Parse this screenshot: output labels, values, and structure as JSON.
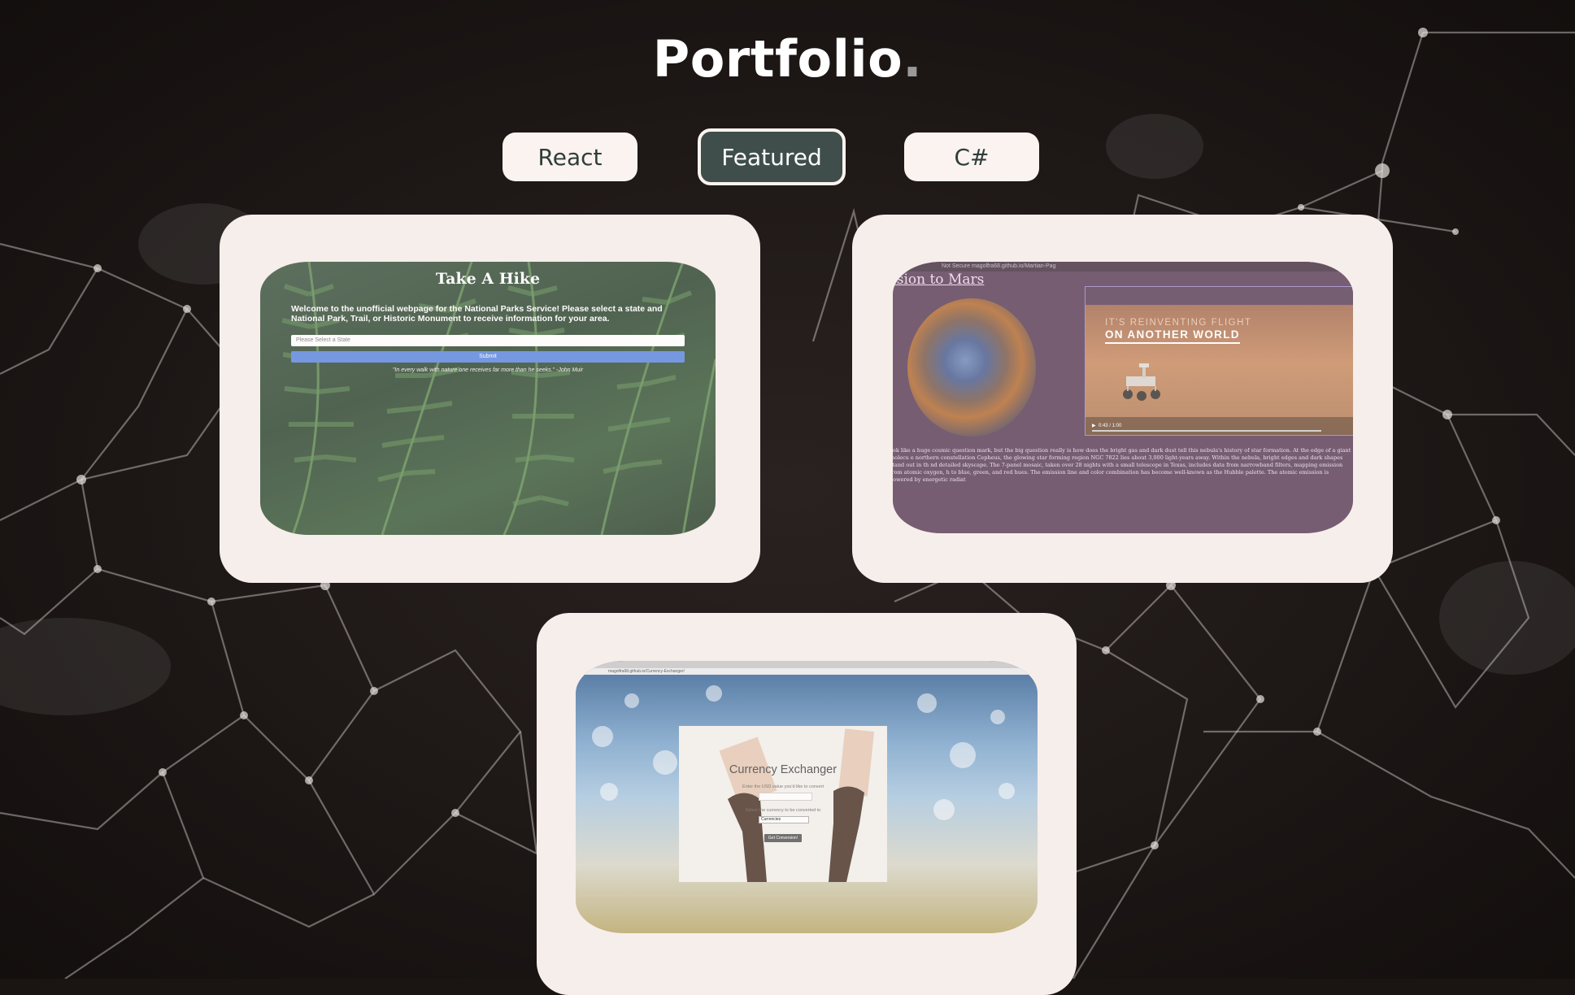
{
  "header": {
    "title": "Portfolio",
    "title_dot": "."
  },
  "filters": [
    {
      "label": "React",
      "active": false
    },
    {
      "label": "Featured",
      "active": true
    },
    {
      "label": "C#",
      "active": false
    }
  ],
  "projects": {
    "hike": {
      "heading": "Take A Hike",
      "intro": "Welcome to the unofficial webpage for the National Parks Service! Please select a state and National Park, Trail, or Historic Monument to receive information for your area.",
      "select_placeholder": "Please Select a State",
      "submit_label": "Submit",
      "quote": "\"In every walk with nature one receives far more than he seeks.\" -John Muir"
    },
    "mars": {
      "browser_bar": "Not Secure  magolfra68.github.io/Martian-Pag",
      "heading": "ssion to Mars",
      "video_line1": "IT'S REINVENTING FLIGHT",
      "video_line2": "ON ANOTHER WORLD",
      "video_time": "0:43 / 1:00",
      "body": "ook like a huge cosmic question mark, but the big question really is how does the bright gas and dark dust tell this nebula's history of star formation. At the edge of a giant molecu e northern constellation Cepheus, the glowing star forming region NGC 7822 lies about 3,000 light-years away. Within the nebula, bright edges and dark shapes stand out in th nd detailed skyscape. The 7-panel mosaic, taken over 28 nights with a small telescope in Texas, includes data from narrowband filters, mapping emission from atomic oxygen, h to blue, green, and red hues. The emission line and color combination has become well-known as the Hubble palette. The atomic emission is powered by energetic radiat"
    },
    "currency": {
      "browser_url": "magolfra68.github.io/Currency-Exchanger/",
      "heading": "Currency Exchanger",
      "label_amount": "Enter the USD value you'd like to convert",
      "label_currency": "Select the currency to be converted to",
      "select_value": "Currencies",
      "button_label": "Get Conversion!"
    }
  },
  "colors": {
    "background": "#1a1412",
    "card": "#f6eeea",
    "button_bg": "#fbf3ef",
    "button_active": "#3f4e4a",
    "button_text": "#2f3d3a"
  }
}
